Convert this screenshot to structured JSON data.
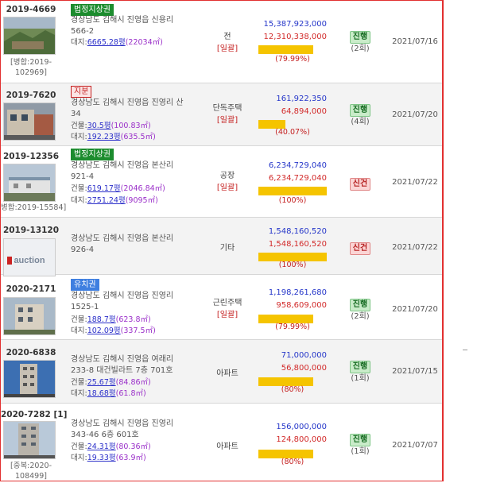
{
  "rows": [
    {
      "case": "2019-4669",
      "badge": "법정지상권",
      "address1": "경상남도 김해시 진영읍 신용리",
      "address2": "566-2",
      "land_label": "대지:",
      "land_pyeong": "6665.28평",
      "land_m2": "(22034㎡)",
      "note1": "[병합:2019-",
      "note2": "102969]",
      "use": "전",
      "bulk": "[일괄]",
      "appraisal": "15,387,923,000",
      "minimum": "12,310,338,000",
      "ratio": "(79.99%)",
      "ratio_value": 79.99,
      "status": "진행",
      "round": "(2회)",
      "date": "2021/07/16"
    },
    {
      "case": "2019-7620",
      "badge": "지분",
      "address1": "경상남도 김해시 진영읍 진영리 산",
      "address2": "34",
      "bldg_label": "건물:",
      "bldg_pyeong": "30.5평",
      "bldg_m2": "(100.83㎡)",
      "land_label": "대지:",
      "land_pyeong": "192.23평",
      "land_m2": "(635.5㎡)",
      "use": "단독주택",
      "bulk": "[일괄]",
      "appraisal": "161,922,350",
      "minimum": "64,894,000",
      "ratio": "(40.07%)",
      "ratio_value": 40.07,
      "status": "진행",
      "round": "(4회)",
      "date": "2021/07/20"
    },
    {
      "case": "2019-12356",
      "badge": "법정지상권",
      "address1": "경상남도 김해시 진영읍 본산리",
      "address2": "921-4",
      "bldg_label": "건물:",
      "bldg_pyeong": "619.17평",
      "bldg_m2": "(2046.84㎡)",
      "land_label": "대지:",
      "land_pyeong": "2751.24평",
      "land_m2": "(9095㎡)",
      "note1": "병합:2019-15584]",
      "use": "공장",
      "bulk": "[일괄]",
      "appraisal": "6,234,729,040",
      "minimum": "6,234,729,040",
      "ratio": "(100%)",
      "ratio_value": 100,
      "status": "신건",
      "date": "2021/07/22"
    },
    {
      "case": "2019-13120",
      "address1": "경상남도 김해시 진영읍 본산리",
      "address2": "926-4",
      "thumb_text": "auction",
      "use": "기타",
      "appraisal": "1,548,160,520",
      "minimum": "1,548,160,520",
      "ratio": "(100%)",
      "ratio_value": 100,
      "status": "신건",
      "date": "2021/07/22"
    },
    {
      "case": "2020-2171",
      "badge": "유치권",
      "address1": "경상남도 김해시 진영읍 진영리",
      "address2": "1525-1",
      "bldg_label": "건물:",
      "bldg_pyeong": "188.7평",
      "bldg_m2": "(623.8㎡)",
      "land_label": "대지:",
      "land_pyeong": "102.09평",
      "land_m2": "(337.5㎡)",
      "use": "근린주택",
      "bulk": "[일괄]",
      "appraisal": "1,198,261,680",
      "minimum": "958,609,000",
      "ratio": "(79.99%)",
      "ratio_value": 79.99,
      "status": "진행",
      "round": "(2회)",
      "date": "2021/07/20"
    },
    {
      "case": "2020-6838",
      "address1": "경상남도 김해시 진영읍 여래리",
      "address2": "233-8 대건빌라트 7층 701호",
      "bldg_label": "건물:",
      "bldg_pyeong": "25.67평",
      "bldg_m2": "(84.86㎡)",
      "land_label": "대지:",
      "land_pyeong": "18.68평",
      "land_m2": "(61.8㎡)",
      "use": "아파트",
      "appraisal": "71,000,000",
      "minimum": "56,800,000",
      "ratio": "(80%)",
      "ratio_value": 80,
      "status": "진행",
      "round": "(1회)",
      "date": "2021/07/15"
    },
    {
      "case": "2020-7282 [1]",
      "address1": "경상남도 김해시 진영읍 진영리",
      "address2": "343-46 6층 601호",
      "bldg_label": "건물:",
      "bldg_pyeong": "24.31평",
      "bldg_m2": "(80.36㎡)",
      "land_label": "대지:",
      "land_pyeong": "19.33평",
      "land_m2": "(63.9㎡)",
      "note1": "[중복:2020-",
      "note2": "108499]",
      "use": "아파트",
      "appraisal": "156,000,000",
      "minimum": "124,800,000",
      "ratio": "(80%)",
      "ratio_value": 80,
      "status": "진행",
      "round": "(1회)",
      "date": "2021/07/07"
    }
  ],
  "colors": {
    "frame": "#e23030",
    "appraisal": "#2536c9",
    "minimum": "#d22a2a",
    "bar": "#f5c400",
    "ongoing": "#13691f",
    "new": "#b52020"
  }
}
